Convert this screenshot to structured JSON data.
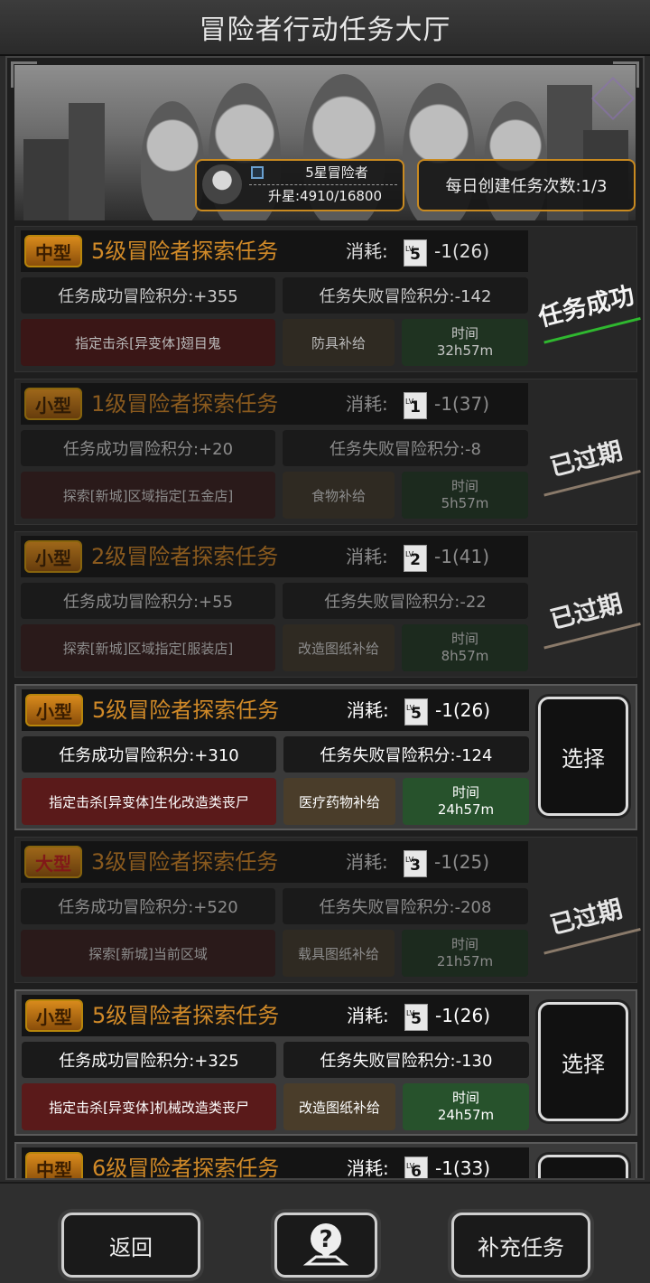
{
  "header": {
    "title": "冒险者行动任务大厅"
  },
  "player": {
    "rank": "5星冒险者",
    "progress": "升星:4910/16800"
  },
  "daily": {
    "text": "每日创建任务次数:1/3"
  },
  "cost_label": "消耗:",
  "time_label": "时间",
  "missions": [
    {
      "size": "中型",
      "title": "5级冒险者探索任务",
      "lv": "5",
      "cost": "-1(26)",
      "success": "任务成功冒险积分:+355",
      "fail": "任务失败冒险积分:-142",
      "target": "指定击杀[异变体]翅目鬼",
      "supply": "防具补给",
      "time": "32h57m",
      "status": "任务成功"
    },
    {
      "size": "小型",
      "title": "1级冒险者探索任务",
      "lv": "1",
      "cost": "-1(37)",
      "success": "任务成功冒险积分:+20",
      "fail": "任务失败冒险积分:-8",
      "target": "探索[新城]区域指定[五金店]",
      "supply": "食物补给",
      "time": "5h57m",
      "status": "已过期"
    },
    {
      "size": "小型",
      "title": "2级冒险者探索任务",
      "lv": "2",
      "cost": "-1(41)",
      "success": "任务成功冒险积分:+55",
      "fail": "任务失败冒险积分:-22",
      "target": "探索[新城]区域指定[服装店]",
      "supply": "改造图纸补给",
      "time": "8h57m",
      "status": "已过期"
    },
    {
      "size": "小型",
      "title": "5级冒险者探索任务",
      "lv": "5",
      "cost": "-1(26)",
      "success": "任务成功冒险积分:+310",
      "fail": "任务失败冒险积分:-124",
      "target": "指定击杀[异变体]生化改造类丧尸",
      "supply": "医疗药物补给",
      "time": "24h57m",
      "status": "选择"
    },
    {
      "size": "大型",
      "title": "3级冒险者探索任务",
      "lv": "3",
      "cost": "-1(25)",
      "success": "任务成功冒险积分:+520",
      "fail": "任务失败冒险积分:-208",
      "target": "探索[新城]当前区域",
      "supply": "载具图纸补给",
      "time": "21h57m",
      "status": "已过期"
    },
    {
      "size": "小型",
      "title": "5级冒险者探索任务",
      "lv": "5",
      "cost": "-1(26)",
      "success": "任务成功冒险积分:+325",
      "fail": "任务失败冒险积分:-130",
      "target": "指定击杀[异变体]机械改造类丧尸",
      "supply": "改造图纸补给",
      "time": "24h57m",
      "status": "选择"
    },
    {
      "size": "中型",
      "title": "6级冒险者探索任务",
      "lv": "6",
      "cost": "-1(33)"
    }
  ],
  "footer": {
    "back": "返回",
    "help_icon": "help-question-icon",
    "add": "补充任务"
  }
}
